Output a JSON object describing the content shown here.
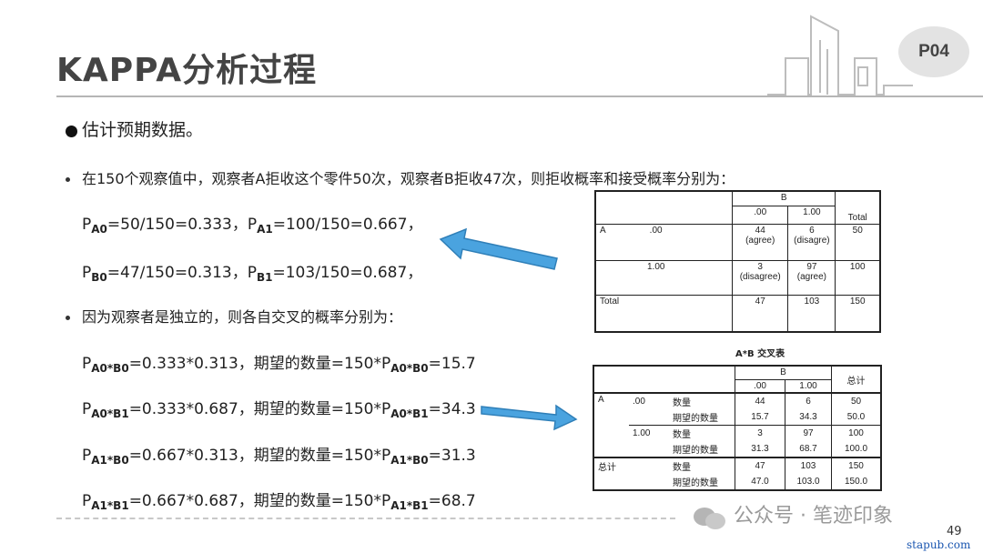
{
  "header": {
    "title": "KAPPA分析过程",
    "page_badge": "P04"
  },
  "body": {
    "heading": "估计预期数据。",
    "bullet1": "在150个观察值中，观察者A拒收这个零件50次，观察者B拒收47次，则拒收概率和接受概率分别为：",
    "bullet2": "因为观察者是独立的，则各自交叉的概率分别为：",
    "prob_line1": {
      "a0_sub": "A0",
      "a0_expr": "=50/150=0.333，",
      "a1_sub": "A1",
      "a1_expr": "=100/150=0.667，"
    },
    "prob_line2": {
      "b0_sub": "B0",
      "b0_expr": "=47/150=0.313，",
      "b1_sub": "B1",
      "b1_expr": "=103/150=0.687，"
    },
    "cross_lines": [
      {
        "sub": "A0*B0",
        "expr": "=0.333*0.313，期望的数量=150*P",
        "sub2": "A0*B0",
        "result": "=15.7"
      },
      {
        "sub": "A0*B1",
        "expr": "=0.333*0.687，期望的数量=150*P",
        "sub2": "A0*B1",
        "result": "=34.3"
      },
      {
        "sub": "A1*B0",
        "expr": "=0.667*0.313，期望的数量=150*P",
        "sub2": "A1*B0",
        "result": "=31.3"
      },
      {
        "sub": "A1*B1",
        "expr": "=0.667*0.687，期望的数量=150*P",
        "sub2": "A1*B1",
        "result": "=68.7"
      }
    ],
    "p_letter": "P"
  },
  "table1": {
    "b_header": "B",
    "cols": [
      ".00",
      "1.00",
      "Total"
    ],
    "row_a_label": "A",
    "rows": [
      {
        "label": ".00",
        "c0": "44",
        "c0n": "(agree)",
        "c1": "6",
        "c1n": "(disagre)",
        "total": "50"
      },
      {
        "label": "1.00",
        "c0": "3",
        "c0n": "(disagree)",
        "c1": "97",
        "c1n": "(agree)",
        "total": "100"
      }
    ],
    "total_row": {
      "label": "Total",
      "c0": "47",
      "c1": "103",
      "total": "150"
    }
  },
  "table2": {
    "caption": "A*B 交叉表",
    "b_header": "B",
    "cols": [
      ".00",
      "1.00"
    ],
    "total_header": "总计",
    "row_a_label": "A",
    "count_label": "数量",
    "expected_label": "期望的数量",
    "rows": [
      {
        "label": ".00",
        "count": [
          "44",
          "6",
          "50"
        ],
        "expected": [
          "15.7",
          "34.3",
          "50.0"
        ]
      },
      {
        "label": "1.00",
        "count": [
          "3",
          "97",
          "100"
        ],
        "expected": [
          "31.3",
          "68.7",
          "100.0"
        ]
      }
    ],
    "total": {
      "label": "总计",
      "count": [
        "47",
        "103",
        "150"
      ],
      "expected": [
        "47.0",
        "103.0",
        "150.0"
      ]
    }
  },
  "footer": {
    "watermark": "公众号 · 笔迹印象",
    "page_number": "49",
    "site": "stapub.com"
  },
  "colors": {
    "arrow": "#4aa3df",
    "arrow_stroke": "#2f7fb8",
    "title": "#444444",
    "rule": "#b5b5b5"
  }
}
